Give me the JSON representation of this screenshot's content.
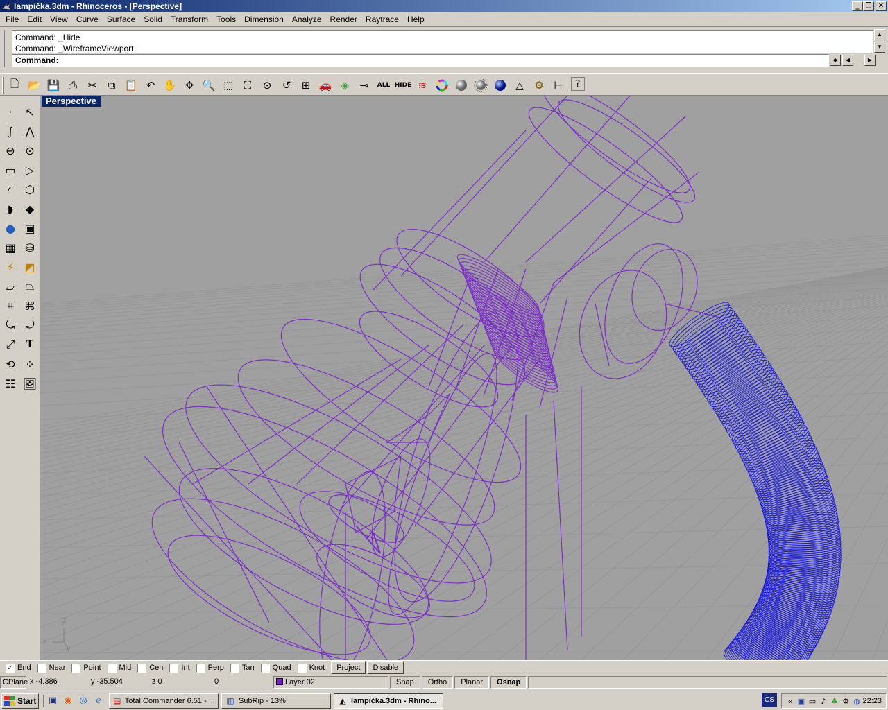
{
  "window": {
    "title": "lampička.3dm - Rhinoceros - [Perspective]",
    "controls": [
      "_",
      "❐",
      "✕"
    ]
  },
  "menu": [
    "File",
    "Edit",
    "View",
    "Curve",
    "Surface",
    "Solid",
    "Transform",
    "Tools",
    "Dimension",
    "Analyze",
    "Render",
    "Raytrace",
    "Help"
  ],
  "command": {
    "history": [
      "Command:  _Hide",
      "Command:  _WireframeViewport"
    ],
    "prompt": "Command:"
  },
  "toolbar": {
    "icons": [
      "new-file-icon",
      "open-file-icon",
      "save-icon",
      "print-icon",
      "cut-icon",
      "copy-icon",
      "paste-icon",
      "undo-icon",
      "pan-hand-icon",
      "rotate-view-icon",
      "zoom-dynamic-icon",
      "zoom-window-icon",
      "zoom-extents-icon",
      "zoom-selected-icon",
      "undo-view-icon",
      "four-viewports-icon",
      "car-object-icon",
      "layer-icon",
      "properties-icon"
    ],
    "all_label": "ALL",
    "hide_label": "HIDE",
    "icons2": [
      "layers-stack-icon",
      "color-wheel-icon",
      "render-sphere-icon",
      "render-sphere-dotted-icon",
      "blue-sphere-icon",
      "light-cone-icon",
      "gear-settings-icon",
      "dimension-icon",
      "help-icon"
    ]
  },
  "viewport": {
    "label": "Perspective",
    "axis_z": "z",
    "axis_x": "x",
    "axis_y": "y",
    "wire_color": "#7b2fc9",
    "hose_color": "#1010e6",
    "grid_color": "#8f8f8f",
    "bg_color": "#a0a0a0"
  },
  "osnap": {
    "items": [
      {
        "label": "End",
        "checked": true
      },
      {
        "label": "Near",
        "checked": false
      },
      {
        "label": "Point",
        "checked": false
      },
      {
        "label": "Mid",
        "checked": false
      },
      {
        "label": "Cen",
        "checked": false
      },
      {
        "label": "Int",
        "checked": false
      },
      {
        "label": "Perp",
        "checked": false
      },
      {
        "label": "Tan",
        "checked": false
      },
      {
        "label": "Quad",
        "checked": false
      },
      {
        "label": "Knot",
        "checked": false
      }
    ],
    "project_label": "Project",
    "disable_label": "Disable"
  },
  "status": {
    "cplane": "CPlane",
    "x": "x -4.386",
    "y": "y -35.504",
    "z": "z 0",
    "extra": "0",
    "layer": "Layer 02",
    "snap": "Snap",
    "ortho": "Ortho",
    "planar": "Planar",
    "osnap": "Osnap"
  },
  "taskbar": {
    "start": "Start",
    "tasks": [
      {
        "label": "Total Commander 6.51 - ...",
        "active": false
      },
      {
        "label": "SubRip - 13%",
        "active": false
      },
      {
        "label": "lampička.3dm - Rhino...",
        "active": true
      }
    ],
    "lang": "CS",
    "clock": "22:23"
  }
}
